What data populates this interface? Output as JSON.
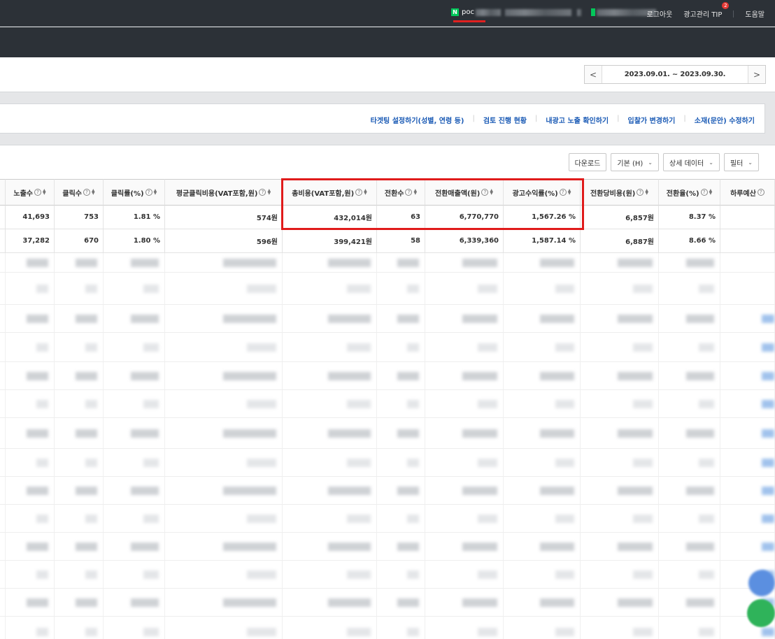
{
  "header": {
    "user_prefix": "poc",
    "logout": "로그아웃",
    "tip": "광고관리 TIP",
    "tip_badge": "2",
    "help": "도움말"
  },
  "datepicker": {
    "range": "2023.09.01. ~ 2023.09.30.",
    "prev": "<",
    "next": ">"
  },
  "links": [
    "타겟팅 설정하기(성별, 연령 등)",
    "검토 진행 현황",
    "내광고 노출 확인하기",
    "입찰가 변경하기",
    "소재(문안) 수정하기"
  ],
  "toolbar": {
    "download": "다운로드",
    "basic": "기본 (H)",
    "detail": "상세 데이터",
    "filter": "필터"
  },
  "table": {
    "columns": [
      "노출수",
      "클릭수",
      "클릭률(%)",
      "평균클릭비용(VAT포함,원)",
      "총비용(VAT포함,원)",
      "전환수",
      "전환매출액(원)",
      "광고수익률(%)",
      "전환당비용(원)",
      "전환율(%)",
      "하루예산"
    ],
    "rows": [
      [
        "41,693",
        "753",
        "1.81 %",
        "574원",
        "432,014원",
        "63",
        "6,770,770",
        "1,567.26 %",
        "6,857원",
        "8.37 %",
        ""
      ],
      [
        "37,282",
        "670",
        "1.80 %",
        "596원",
        "399,421원",
        "58",
        "6,339,360",
        "1,587.14 %",
        "6,887원",
        "8.66 %",
        ""
      ]
    ]
  },
  "colors": {
    "topbar": "#2c3137",
    "link": "#1a5ab5",
    "highlight": "#e01b1b"
  }
}
